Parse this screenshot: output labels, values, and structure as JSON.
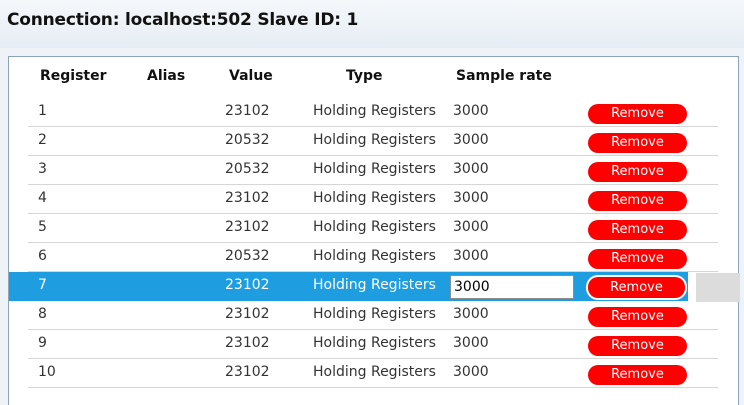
{
  "connection": {
    "title": "Connection: localhost:502 Slave ID: 1"
  },
  "table": {
    "columns": {
      "register": "Register",
      "alias": "Alias",
      "value": "Value",
      "type": "Type",
      "sample_rate": "Sample rate"
    },
    "rows": [
      {
        "register": "1",
        "alias": "",
        "value": "23102",
        "type": "Holding Registers",
        "sample_rate": "3000",
        "action": "Remove"
      },
      {
        "register": "2",
        "alias": "",
        "value": "20532",
        "type": "Holding Registers",
        "sample_rate": "3000",
        "action": "Remove"
      },
      {
        "register": "3",
        "alias": "",
        "value": "20532",
        "type": "Holding Registers",
        "sample_rate": "3000",
        "action": "Remove"
      },
      {
        "register": "4",
        "alias": "",
        "value": "23102",
        "type": "Holding Registers",
        "sample_rate": "3000",
        "action": "Remove"
      },
      {
        "register": "5",
        "alias": "",
        "value": "23102",
        "type": "Holding Registers",
        "sample_rate": "3000",
        "action": "Remove"
      },
      {
        "register": "6",
        "alias": "",
        "value": "20532",
        "type": "Holding Registers",
        "sample_rate": "3000",
        "action": "Remove"
      },
      {
        "register": "7",
        "alias": "",
        "value": "23102",
        "type": "Holding Registers",
        "sample_rate": "3000",
        "action": "Remove",
        "selected": true
      },
      {
        "register": "8",
        "alias": "",
        "value": "23102",
        "type": "Holding Registers",
        "sample_rate": "3000",
        "action": "Remove"
      },
      {
        "register": "9",
        "alias": "",
        "value": "23102",
        "type": "Holding Registers",
        "sample_rate": "3000",
        "action": "Remove"
      },
      {
        "register": "10",
        "alias": "",
        "value": "23102",
        "type": "Holding Registers",
        "sample_rate": "3000",
        "action": "Remove"
      }
    ]
  },
  "colors": {
    "selection": "#1e9ee0",
    "remove_button": "#ff0000"
  }
}
